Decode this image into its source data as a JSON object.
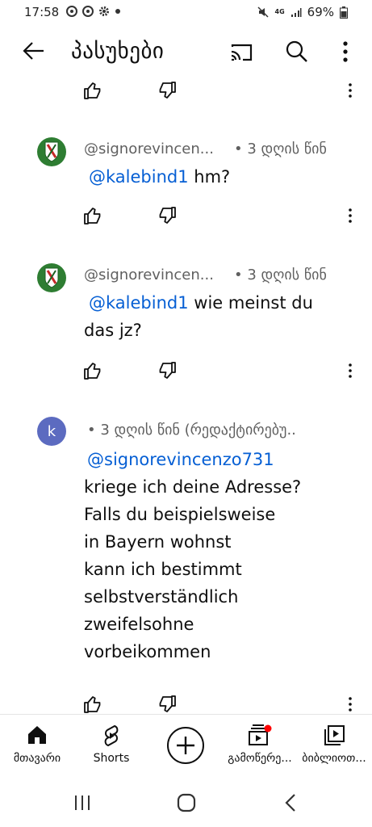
{
  "status_bar": {
    "time": "17:58",
    "network": "4G",
    "battery": "69%"
  },
  "header": {
    "title": "პასუხები"
  },
  "comments": [
    {
      "author": "@signorevincen...",
      "time": "• 3 დღის წინ",
      "mention": "@kalebind1",
      "text": " hm?"
    },
    {
      "author": "@signorevincen...",
      "time": "• 3 დღის წინ",
      "mention": "@kalebind1",
      "text_line1": " wie meinst du",
      "text_line2": "das jz?"
    },
    {
      "avatar_letter": "k",
      "time": "• 3 დღის წინ (რედაქტირებუ..",
      "mention": "@signorevincenzo731",
      "lines": [
        "kriege ich deine Adresse?",
        "Falls du beispielsweise",
        "in Bayern wohnst",
        "kann ich bestimmt",
        "selbstverständlich",
        "zweifelsohne",
        "vorbeikommen"
      ]
    }
  ],
  "bottom_nav": {
    "home": "მთავარი",
    "shorts": "Shorts",
    "subscriptions": "გამოწერე...",
    "library": "ბიბლიოთ..."
  },
  "colors": {
    "accent_link": "#065fd4",
    "avatar_k": "#5c6bc0",
    "notification_dot": "#ff0000"
  }
}
